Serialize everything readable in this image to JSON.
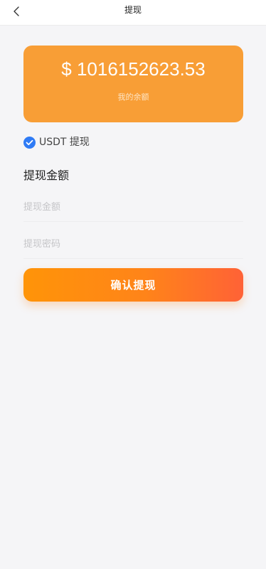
{
  "header": {
    "title": "提现",
    "back_icon": "chevron-left-icon"
  },
  "balance": {
    "amount": "$ 1016152623.53",
    "caption": "我的余额",
    "card_color": "#f89e36"
  },
  "withdraw_option": {
    "label": "USDT 提现",
    "checked": true,
    "check_color": "#2f7bf5"
  },
  "form": {
    "section_title": "提现金额",
    "amount_placeholder": "提现金额",
    "amount_value": "",
    "password_placeholder": "提现密码",
    "password_value": ""
  },
  "confirm": {
    "label": "确认提现",
    "accent": "#ff8a14"
  }
}
